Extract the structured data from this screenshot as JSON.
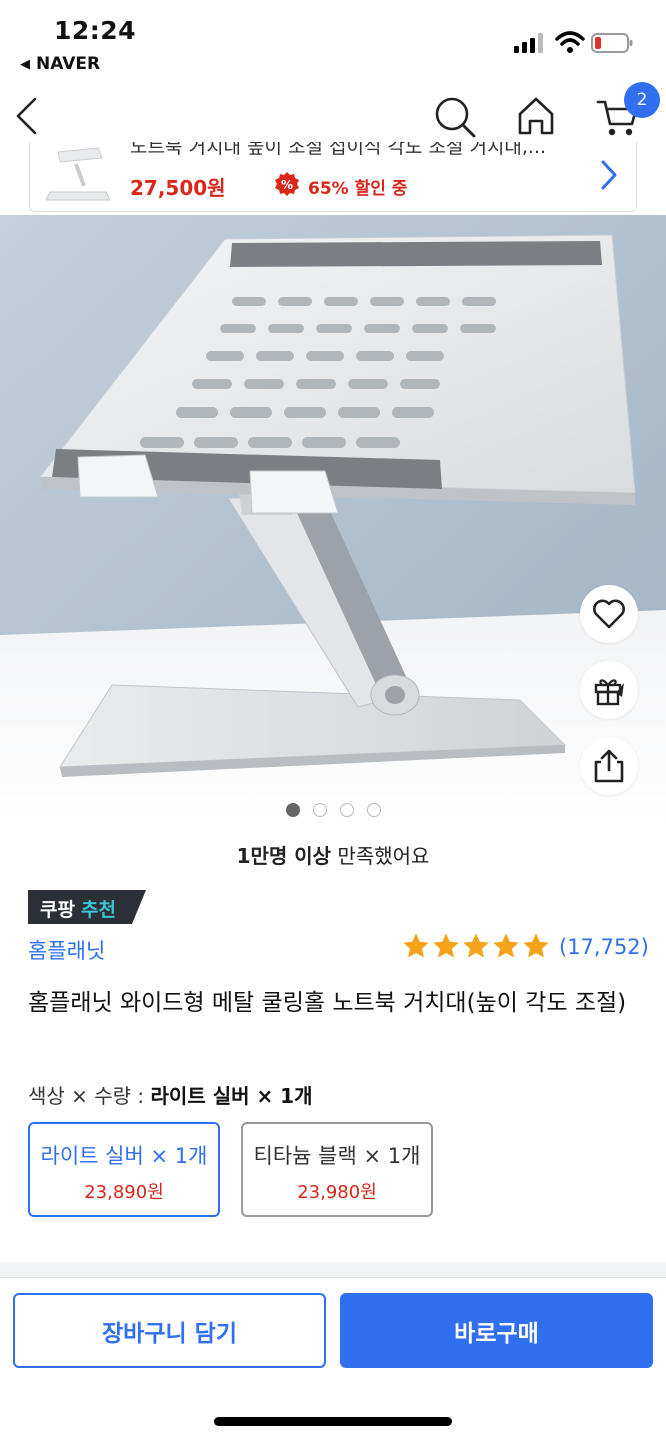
{
  "status_bar": {
    "time": "12:24",
    "back_app": "NAVER",
    "back_app_icon": "triangle-left-icon"
  },
  "nav": {
    "cart_count": "2",
    "icons": [
      "back-icon",
      "search-icon",
      "home-icon",
      "cart-icon"
    ]
  },
  "mini_banner": {
    "title": "노트북 거치대 높이 조절 접이식 각도 조절 거치대,...",
    "price": "27,500원",
    "discount_icon": "%",
    "discount": "65% 할인 중"
  },
  "hero": {
    "slide_count": 4,
    "active_slide": 1,
    "actions": [
      "heart-icon",
      "gift-icon",
      "share-icon"
    ]
  },
  "info": {
    "satisfied_bold": "1만명 이상",
    "satisfied_rest": " 만족했어요",
    "recommend_part1": "쿠팡",
    "recommend_part2": "추천",
    "brand": "홈플래닛",
    "rating_stars": 5,
    "reviews": "(17,752)",
    "title": "홈플래닛 와이드형 메탈 쿨링홀 노트북 거치대(높이 각도 조절)"
  },
  "options": {
    "label": "색상 × 수량 : ",
    "label_value": "라이트 실버 × 1개",
    "items": [
      {
        "name": "라이트 실버 × 1개",
        "price": "23,890원",
        "selected": true
      },
      {
        "name": "티타늄 블랙 × 1개",
        "price": "23,980원",
        "selected": false
      }
    ]
  },
  "buttons": {
    "cart": "장바구니 담기",
    "buy": "바로구매"
  },
  "colors": {
    "accent": "#2f6ff0",
    "price_red": "#d9271c",
    "star": "#f5a31a",
    "recommend_bg": "#2b3036",
    "recommend_accent": "#38c7d6"
  }
}
